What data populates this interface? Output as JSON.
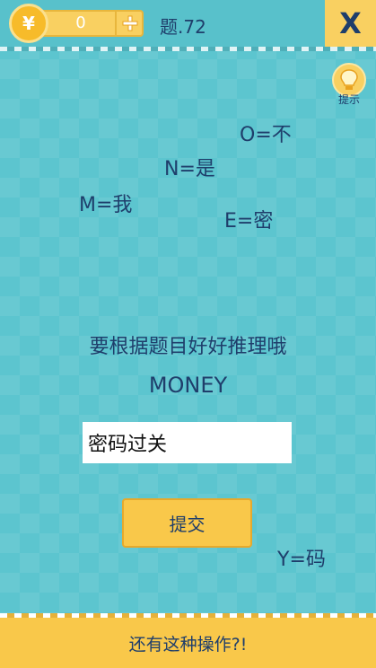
{
  "header": {
    "coin_symbol": "¥",
    "coins": "0",
    "add_symbol": "+",
    "level": "题.72",
    "close_symbol": "X"
  },
  "hint": {
    "label": "提示"
  },
  "clues": {
    "o": "O=不",
    "n": "N=是",
    "m": "M=我",
    "e": "E=密",
    "y": "Y=码"
  },
  "puzzle": {
    "question": "要根据题目好好推理哦",
    "word": "MONEY"
  },
  "answer": {
    "value": "密码过关"
  },
  "submit": {
    "label": "提交"
  },
  "footer": {
    "text": "还有这种操作?!"
  }
}
